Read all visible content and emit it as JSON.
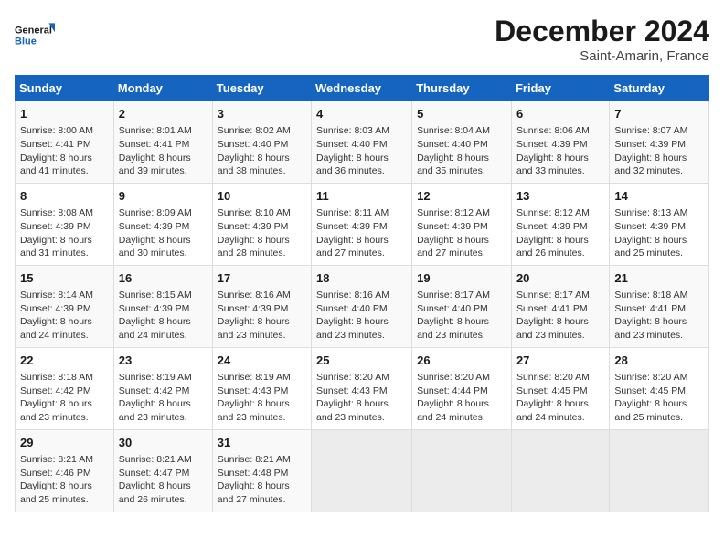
{
  "logo": {
    "line1": "General",
    "line2": "Blue"
  },
  "title": "December 2024",
  "subtitle": "Saint-Amarin, France",
  "days_of_week": [
    "Sunday",
    "Monday",
    "Tuesday",
    "Wednesday",
    "Thursday",
    "Friday",
    "Saturday"
  ],
  "weeks": [
    [
      {
        "day": 1,
        "info": "Sunrise: 8:00 AM\nSunset: 4:41 PM\nDaylight: 8 hours\nand 41 minutes."
      },
      {
        "day": 2,
        "info": "Sunrise: 8:01 AM\nSunset: 4:41 PM\nDaylight: 8 hours\nand 39 minutes."
      },
      {
        "day": 3,
        "info": "Sunrise: 8:02 AM\nSunset: 4:40 PM\nDaylight: 8 hours\nand 38 minutes."
      },
      {
        "day": 4,
        "info": "Sunrise: 8:03 AM\nSunset: 4:40 PM\nDaylight: 8 hours\nand 36 minutes."
      },
      {
        "day": 5,
        "info": "Sunrise: 8:04 AM\nSunset: 4:40 PM\nDaylight: 8 hours\nand 35 minutes."
      },
      {
        "day": 6,
        "info": "Sunrise: 8:06 AM\nSunset: 4:39 PM\nDaylight: 8 hours\nand 33 minutes."
      },
      {
        "day": 7,
        "info": "Sunrise: 8:07 AM\nSunset: 4:39 PM\nDaylight: 8 hours\nand 32 minutes."
      }
    ],
    [
      {
        "day": 8,
        "info": "Sunrise: 8:08 AM\nSunset: 4:39 PM\nDaylight: 8 hours\nand 31 minutes."
      },
      {
        "day": 9,
        "info": "Sunrise: 8:09 AM\nSunset: 4:39 PM\nDaylight: 8 hours\nand 30 minutes."
      },
      {
        "day": 10,
        "info": "Sunrise: 8:10 AM\nSunset: 4:39 PM\nDaylight: 8 hours\nand 28 minutes."
      },
      {
        "day": 11,
        "info": "Sunrise: 8:11 AM\nSunset: 4:39 PM\nDaylight: 8 hours\nand 27 minutes."
      },
      {
        "day": 12,
        "info": "Sunrise: 8:12 AM\nSunset: 4:39 PM\nDaylight: 8 hours\nand 27 minutes."
      },
      {
        "day": 13,
        "info": "Sunrise: 8:12 AM\nSunset: 4:39 PM\nDaylight: 8 hours\nand 26 minutes."
      },
      {
        "day": 14,
        "info": "Sunrise: 8:13 AM\nSunset: 4:39 PM\nDaylight: 8 hours\nand 25 minutes."
      }
    ],
    [
      {
        "day": 15,
        "info": "Sunrise: 8:14 AM\nSunset: 4:39 PM\nDaylight: 8 hours\nand 24 minutes."
      },
      {
        "day": 16,
        "info": "Sunrise: 8:15 AM\nSunset: 4:39 PM\nDaylight: 8 hours\nand 24 minutes."
      },
      {
        "day": 17,
        "info": "Sunrise: 8:16 AM\nSunset: 4:39 PM\nDaylight: 8 hours\nand 23 minutes."
      },
      {
        "day": 18,
        "info": "Sunrise: 8:16 AM\nSunset: 4:40 PM\nDaylight: 8 hours\nand 23 minutes."
      },
      {
        "day": 19,
        "info": "Sunrise: 8:17 AM\nSunset: 4:40 PM\nDaylight: 8 hours\nand 23 minutes."
      },
      {
        "day": 20,
        "info": "Sunrise: 8:17 AM\nSunset: 4:41 PM\nDaylight: 8 hours\nand 23 minutes."
      },
      {
        "day": 21,
        "info": "Sunrise: 8:18 AM\nSunset: 4:41 PM\nDaylight: 8 hours\nand 23 minutes."
      }
    ],
    [
      {
        "day": 22,
        "info": "Sunrise: 8:18 AM\nSunset: 4:42 PM\nDaylight: 8 hours\nand 23 minutes."
      },
      {
        "day": 23,
        "info": "Sunrise: 8:19 AM\nSunset: 4:42 PM\nDaylight: 8 hours\nand 23 minutes."
      },
      {
        "day": 24,
        "info": "Sunrise: 8:19 AM\nSunset: 4:43 PM\nDaylight: 8 hours\nand 23 minutes."
      },
      {
        "day": 25,
        "info": "Sunrise: 8:20 AM\nSunset: 4:43 PM\nDaylight: 8 hours\nand 23 minutes."
      },
      {
        "day": 26,
        "info": "Sunrise: 8:20 AM\nSunset: 4:44 PM\nDaylight: 8 hours\nand 24 minutes."
      },
      {
        "day": 27,
        "info": "Sunrise: 8:20 AM\nSunset: 4:45 PM\nDaylight: 8 hours\nand 24 minutes."
      },
      {
        "day": 28,
        "info": "Sunrise: 8:20 AM\nSunset: 4:45 PM\nDaylight: 8 hours\nand 25 minutes."
      }
    ],
    [
      {
        "day": 29,
        "info": "Sunrise: 8:21 AM\nSunset: 4:46 PM\nDaylight: 8 hours\nand 25 minutes."
      },
      {
        "day": 30,
        "info": "Sunrise: 8:21 AM\nSunset: 4:47 PM\nDaylight: 8 hours\nand 26 minutes."
      },
      {
        "day": 31,
        "info": "Sunrise: 8:21 AM\nSunset: 4:48 PM\nDaylight: 8 hours\nand 27 minutes."
      },
      null,
      null,
      null,
      null
    ]
  ]
}
